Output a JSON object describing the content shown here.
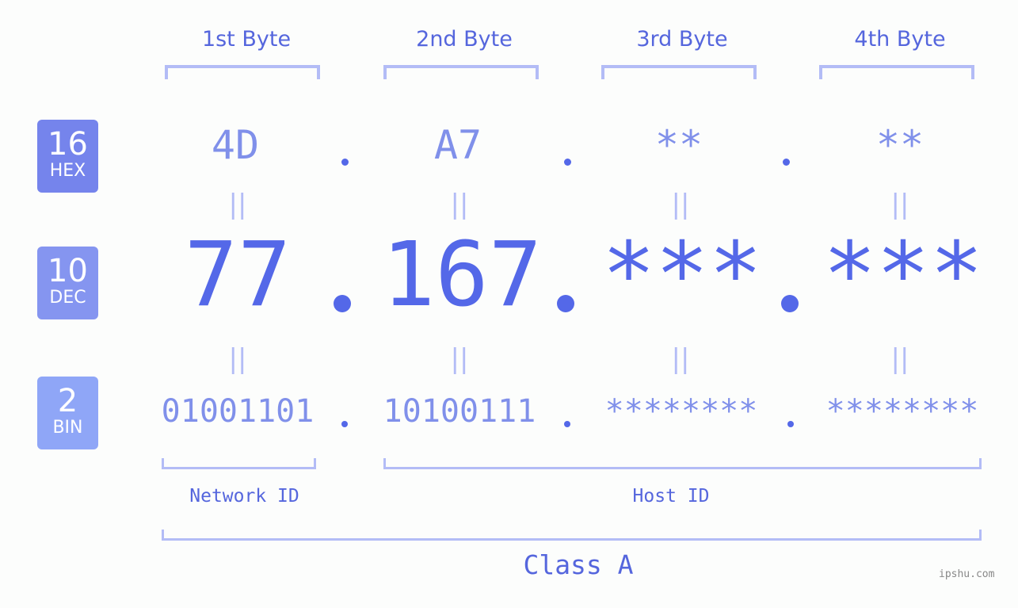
{
  "bytes": {
    "headers": [
      "1st Byte",
      "2nd Byte",
      "3rd Byte",
      "4th Byte"
    ],
    "hex": [
      "4D",
      "A7",
      "**",
      "**"
    ],
    "dec": [
      "77",
      "167",
      "***",
      "***"
    ],
    "bin": [
      "01001101",
      "10100111",
      "********",
      "********"
    ]
  },
  "badges": [
    {
      "number": "16",
      "label": "HEX",
      "color": "#7584ec"
    },
    {
      "number": "10",
      "label": "DEC",
      "color": "#8595f0"
    },
    {
      "number": "2",
      "label": "BIN",
      "color": "#8fa6f7"
    }
  ],
  "equals_glyph": "||",
  "ranges": {
    "network_label": "Network ID",
    "host_label": "Host ID",
    "class_label": "Class A"
  },
  "watermark": "ipshu.com",
  "colors": {
    "accent": "#5468e8",
    "bracket": "#b3bcf6",
    "text": "#5566dd"
  }
}
